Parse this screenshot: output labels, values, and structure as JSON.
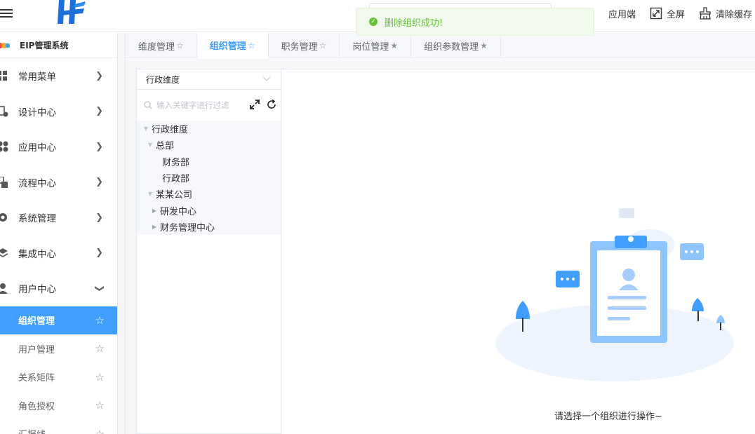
{
  "header": {
    "actions": [
      {
        "label": "应用端",
        "icon": "app-terminal-icon"
      },
      {
        "label": "全屏",
        "icon": "fullscreen-icon"
      },
      {
        "label": "清除缓存",
        "icon": "clear-cache-icon"
      }
    ]
  },
  "toast": {
    "message": "删除组织成功!",
    "type": "success",
    "color": "#67c23a"
  },
  "sidebar": {
    "system_title": "EIP管理系统",
    "items": [
      {
        "label": "常用菜单",
        "icon": "grid-icon"
      },
      {
        "label": "设计中心",
        "icon": "design-icon"
      },
      {
        "label": "应用中心",
        "icon": "app-icon"
      },
      {
        "label": "流程中心",
        "icon": "flow-icon"
      },
      {
        "label": "系统管理",
        "icon": "gear-icon"
      },
      {
        "label": "集成中心",
        "icon": "layers-icon"
      },
      {
        "label": "用户中心",
        "icon": "user-icon",
        "expanded": true
      }
    ],
    "sub_items": [
      {
        "label": "组织管理",
        "active": true
      },
      {
        "label": "用户管理"
      },
      {
        "label": "关系矩阵"
      },
      {
        "label": "角色授权"
      },
      {
        "label": "汇报线"
      }
    ]
  },
  "tabs": [
    {
      "label": "维度管理",
      "star": "☆"
    },
    {
      "label": "组织管理",
      "star": "☆",
      "active": true
    },
    {
      "label": "职务管理",
      "star": "☆"
    },
    {
      "label": "岗位管理",
      "star": "★"
    },
    {
      "label": "组织参数管理",
      "star": "★"
    }
  ],
  "org_panel": {
    "dimension_selected": "行政维度",
    "filter_placeholder": "输入关键字进行过滤",
    "filter_value": "",
    "tree": [
      {
        "label": "行政维度",
        "level": 0,
        "toggle": "expanded"
      },
      {
        "label": "总部",
        "level": 1,
        "toggle": "expanded"
      },
      {
        "label": "财务部",
        "level": 2,
        "toggle": "none"
      },
      {
        "label": "行政部",
        "level": 2,
        "toggle": "none"
      },
      {
        "label": "某某公司",
        "level": 1,
        "toggle": "expanded"
      },
      {
        "label": "研发中心",
        "level": 2,
        "toggle": "collapsed"
      },
      {
        "label": "财务管理中心",
        "level": 2,
        "toggle": "collapsed"
      }
    ]
  },
  "empty_state": {
    "message": "请选择一个组织进行操作~"
  },
  "colors": {
    "primary": "#409eff",
    "success": "#67c23a",
    "text": "#303133",
    "muted": "#606266"
  }
}
